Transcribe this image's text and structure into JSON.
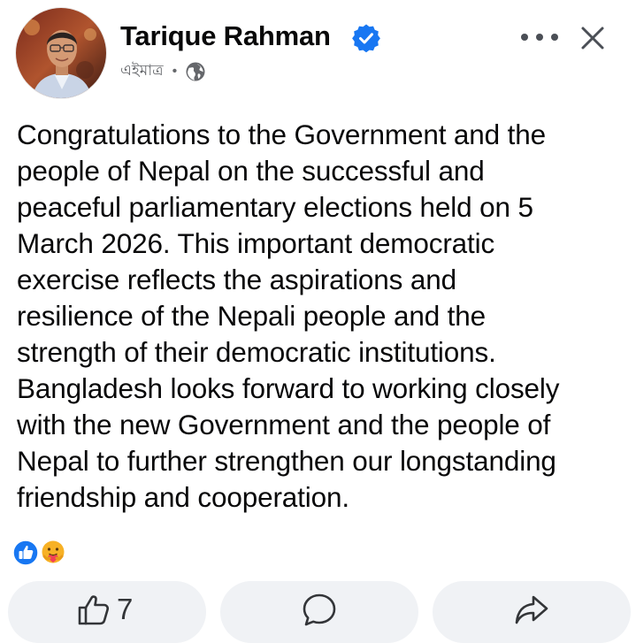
{
  "post": {
    "author": {
      "name": "Tarique Rahman",
      "verified": true
    },
    "time": "এইমাত্র",
    "privacy_icon": "globe-icon",
    "text": "Congratulations to the Government and the\npeople of Nepal on the successful and\npeaceful parliamentary elections held on 5\nMarch 2026. This important democratic\nexercise reflects the aspirations and\nresilience of the Nepali people and the\nstrength of their democratic institutions.\nBangladesh looks forward to working closely\nwith the new Government and the people of\nNepal to further strengthen our longstanding\nfriendship and cooperation."
  },
  "header_actions": {
    "more_icon": "more-dots-icon",
    "close_icon": "close-icon"
  },
  "reactions": {
    "icons": [
      "like-reaction-icon",
      "care-reaction-icon"
    ]
  },
  "actions": {
    "like_count": "7",
    "like_icon": "thumbs-up-icon",
    "comment_icon": "comment-icon",
    "share_icon": "share-icon"
  },
  "colors": {
    "verified_blue": "#1877f2",
    "secondary_text": "#65676b",
    "button_background": "#f0f2f5"
  }
}
